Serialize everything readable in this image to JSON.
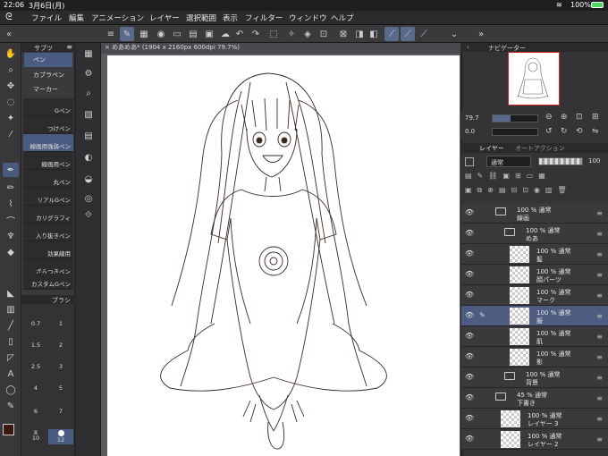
{
  "status": {
    "time": "22:06",
    "date": "3月6日(月)",
    "battery": "100%"
  },
  "menu": [
    "ファイル",
    "編集",
    "アニメーション",
    "レイヤー",
    "選択範囲",
    "表示",
    "フィルター",
    "ウィンドウ",
    "ヘルプ"
  ],
  "document": {
    "title": "めあめあ* (1904 x 2160px 600dpi 79.7%)"
  },
  "subtool": {
    "header": "サブツ",
    "groups": [
      "ペン",
      "カブラペン",
      "マーカー"
    ],
    "brushes": [
      "Gペン",
      "つけペン",
      "線画用強弱ペン",
      "線画用ペン",
      "丸ペン",
      "リアルGペン",
      "カリグラフィ",
      "入り抜きペン",
      "効果線用",
      "ざらつきペン",
      "カスタムGペン"
    ],
    "selected_brush": "線画用強弱ペン"
  },
  "brush_size": {
    "header": "ブラシ",
    "sizes": [
      "0.7",
      "1",
      "1.5",
      "2",
      "2.5",
      "3",
      "4",
      "5",
      "6",
      "7",
      "8",
      "10",
      "12"
    ],
    "selected": "12"
  },
  "navigator": {
    "tab": "ナビゲーター",
    "zoom": "79.7",
    "rotation": "0.0"
  },
  "layer_panel": {
    "tabs": [
      "レイヤー",
      "オートアクション"
    ],
    "blend_mode": "通常",
    "opacity": "100",
    "layers": [
      {
        "type": "folder",
        "line1": "100 % 通常",
        "line2": "線画",
        "indent": 0,
        "selected": false
      },
      {
        "type": "folder",
        "line1": "100 % 通常",
        "line2": "めあ",
        "indent": 1,
        "selected": false
      },
      {
        "type": "layer",
        "line1": "100 % 通常",
        "line2": "髪",
        "indent": 2,
        "selected": false
      },
      {
        "type": "layer",
        "line1": "100 % 通常",
        "line2": "顔パーツ",
        "indent": 2,
        "selected": false
      },
      {
        "type": "layer",
        "line1": "100 % 通常",
        "line2": "マーク",
        "indent": 2,
        "selected": false
      },
      {
        "type": "layer",
        "line1": "100 % 通常",
        "line2": "服",
        "indent": 2,
        "selected": true
      },
      {
        "type": "layer",
        "line1": "100 % 通常",
        "line2": "肌",
        "indent": 2,
        "selected": false
      },
      {
        "type": "layer",
        "line1": "100 % 通常",
        "line2": "影",
        "indent": 2,
        "selected": false
      },
      {
        "type": "folder",
        "line1": "100 % 通常",
        "line2": "背景",
        "indent": 1,
        "selected": false
      },
      {
        "type": "folder",
        "line1": "45 % 通常",
        "line2": "下書き",
        "indent": 0,
        "selected": false
      },
      {
        "type": "layer",
        "line1": "100 % 通常",
        "line2": "レイヤー 3",
        "indent": 1,
        "selected": false
      },
      {
        "type": "layer",
        "line1": "100 % 通常",
        "line2": "レイヤー 2",
        "indent": 1,
        "selected": false
      }
    ]
  },
  "colors": {
    "accent": "#4b5c82",
    "main_color": "#3a1a10",
    "sub_color": "#ffffff"
  },
  "icons": [
    "brush-icon",
    "eraser-icon",
    "pen-icon",
    "move-icon",
    "lasso-icon",
    "eyedropper-icon",
    "fill-icon",
    "text-icon",
    "undo-icon",
    "redo-icon",
    "eye-icon",
    "folder-icon"
  ]
}
